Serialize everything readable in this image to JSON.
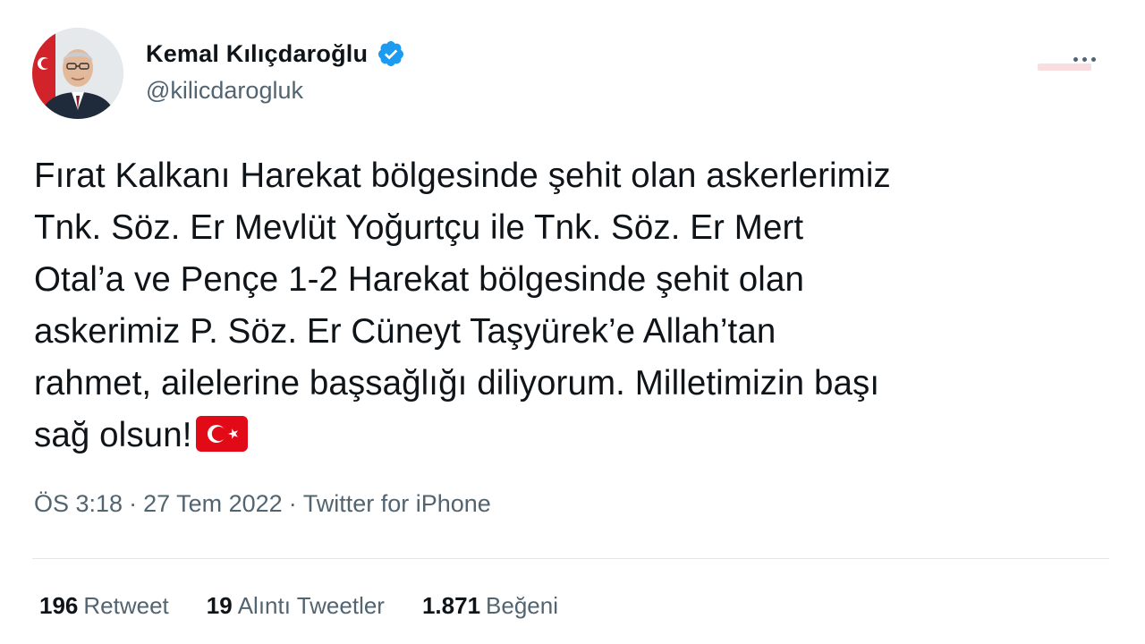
{
  "user": {
    "display_name": "Kemal Kılıçdaroğlu",
    "handle": "@kilicdarogluk",
    "verified": true
  },
  "tweet": {
    "text_lines": [
      "Fırat Kalkanı Harekat bölgesinde şehit olan askerlerimiz",
      "Tnk. Söz. Er Mevlüt Yoğurtçu ile Tnk. Söz. Er Mert",
      "Otal’a ve Pençe 1-2 Harekat bölgesinde şehit olan",
      "askerimiz P. Söz. Er Cüneyt Taşyürek’e Allah’tan",
      "rahmet, ailelerine başsağlığı diliyorum. Milletimizin başı",
      "sağ olsun!"
    ],
    "emoji": "flag-turkey-icon"
  },
  "meta": {
    "time": "ÖS 3:18",
    "date": "27 Tem 2022",
    "separator": "·",
    "source": "Twitter for iPhone"
  },
  "stats": [
    {
      "count": "196",
      "label": "Retweet"
    },
    {
      "count": "19",
      "label": "Alıntı Tweetler"
    },
    {
      "count": "1.871",
      "label": "Beğeni"
    }
  ],
  "colors": {
    "text": "#0f1419",
    "secondary": "#536471",
    "verified": "#1d9bf0",
    "divider": "#e3e7ea",
    "flag": "#e30a17"
  }
}
